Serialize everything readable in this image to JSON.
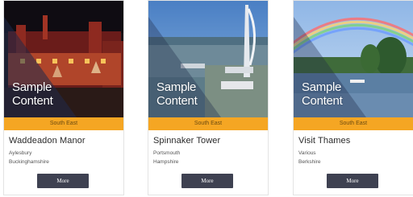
{
  "overlay_text": "Sample\nContent",
  "more_label": "More",
  "colors": {
    "region_bar": "#f5a623",
    "button": "#3e4151"
  },
  "cards": [
    {
      "region": "South East",
      "title": "Waddeadon Manor",
      "line1": "Aylesbury",
      "line2": "Buckinghamshire"
    },
    {
      "region": "South East",
      "title": "Spinnaker Tower",
      "line1": "Portsmouth",
      "line2": "Hampshire"
    },
    {
      "region": "South East",
      "title": "Visit Thames",
      "line1": "Various",
      "line2": "Berkshire"
    }
  ]
}
